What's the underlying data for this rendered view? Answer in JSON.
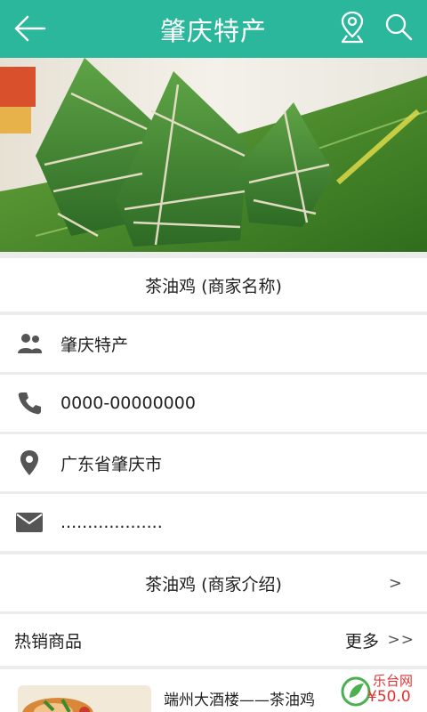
{
  "header": {
    "title": "肇庆特产",
    "back_icon": "arrow-left-icon",
    "location_icon": "map-pin-icon",
    "search_icon": "search-icon",
    "color": "#2ab79b"
  },
  "banner": {
    "subject": "zongzi-photo"
  },
  "merchant": {
    "name": "茶油鸡 (商家名称)"
  },
  "info": [
    {
      "icon": "people-icon",
      "text": "肇庆特产"
    },
    {
      "icon": "phone-icon",
      "text": "0000-00000000"
    },
    {
      "icon": "location-icon",
      "text": "广东省肇庆市"
    },
    {
      "icon": "mail-icon",
      "text": "..................."
    }
  ],
  "intro": {
    "label": "茶油鸡 (商家介绍)",
    "chevron": ">"
  },
  "hot": {
    "title": "热销商品",
    "more": "更多",
    "more_arrow": ">>"
  },
  "product": {
    "name": "端州大酒楼——茶油鸡",
    "price": "¥50.0"
  },
  "watermark": {
    "text": "乐台网"
  }
}
